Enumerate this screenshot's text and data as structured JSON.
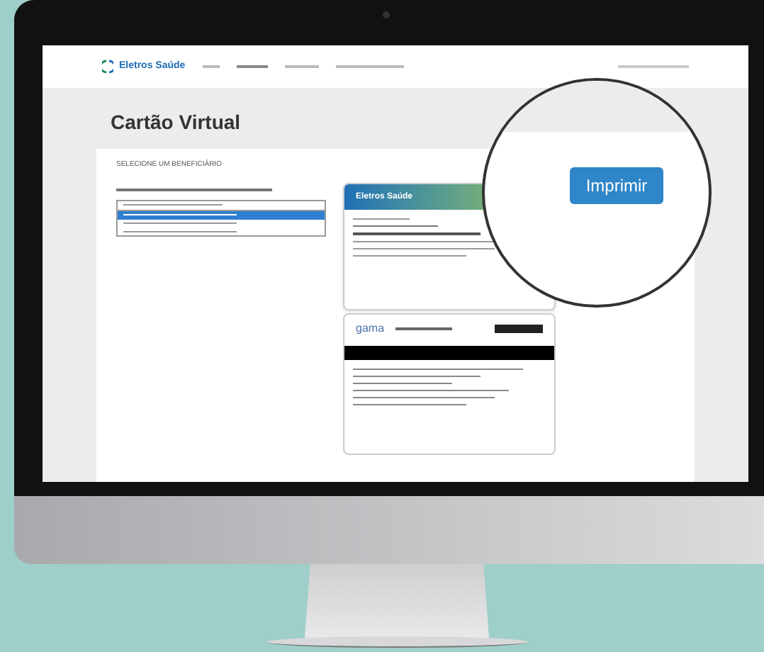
{
  "header": {
    "brand": "Eletros Saúde"
  },
  "page_title": "Cartão Virtual",
  "section_label": "SELECIONE UM BENEFICIÁRIO",
  "dropdown_options": [
    {
      "selected": true
    },
    {
      "selected": false
    },
    {
      "selected": false
    }
  ],
  "card_front": {
    "brand": "Eletros Saúde"
  },
  "card_back": {
    "brand": "gama"
  },
  "magnifier": {
    "button": "Imprimir"
  }
}
